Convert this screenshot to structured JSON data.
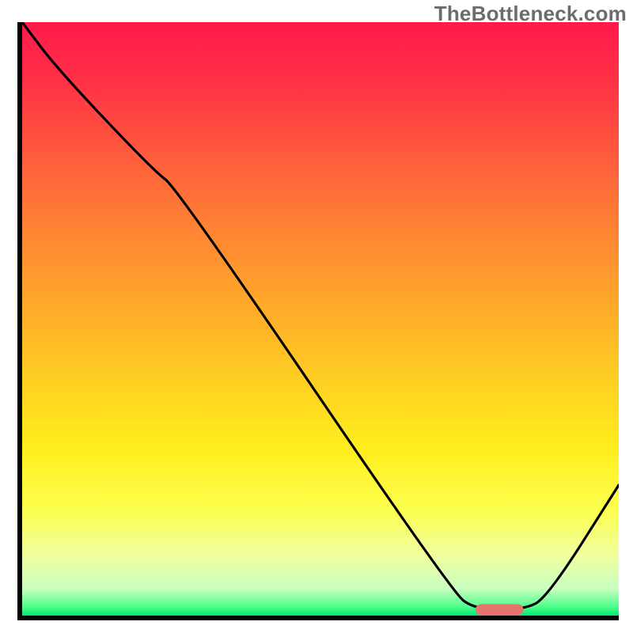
{
  "watermark": "TheBottleneck.com",
  "chart_data": {
    "type": "line",
    "title": "",
    "xlabel": "",
    "ylabel": "",
    "xlim": [
      0,
      100
    ],
    "ylim": [
      0,
      100
    ],
    "background_gradient_stops": [
      {
        "offset": 0.0,
        "color": "#ff1a4a"
      },
      {
        "offset": 0.1,
        "color": "#ff3146"
      },
      {
        "offset": 0.22,
        "color": "#ff5a3d"
      },
      {
        "offset": 0.35,
        "color": "#ff8433"
      },
      {
        "offset": 0.48,
        "color": "#ffaa2a"
      },
      {
        "offset": 0.6,
        "color": "#ffce22"
      },
      {
        "offset": 0.72,
        "color": "#ffee1e"
      },
      {
        "offset": 0.82,
        "color": "#fdff4e"
      },
      {
        "offset": 0.9,
        "color": "#f0ffa0"
      },
      {
        "offset": 0.955,
        "color": "#c8ffc0"
      },
      {
        "offset": 0.985,
        "color": "#4fff8a"
      },
      {
        "offset": 1.0,
        "color": "#00e874"
      }
    ],
    "series": [
      {
        "name": "bottleneck-curve",
        "x": [
          0,
          6,
          22,
          26,
          72,
          76,
          84,
          88,
          100
        ],
        "y": [
          100,
          92,
          75,
          72,
          4,
          1,
          1,
          3,
          22
        ]
      }
    ],
    "marker": {
      "name": "optimal-range",
      "x_start": 76,
      "x_end": 84,
      "y": 1,
      "color": "#e7756f"
    },
    "annotations": []
  }
}
